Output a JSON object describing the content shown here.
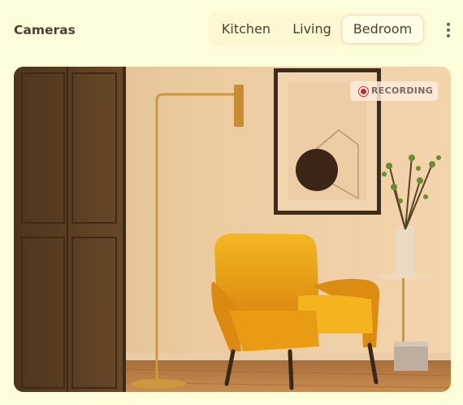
{
  "header": {
    "title": "Cameras",
    "tabs": [
      "Kitchen",
      "Living",
      "Bedroom"
    ],
    "active_tab": "Bedroom"
  },
  "feed": {
    "status_label": "RECORDING",
    "status_color": "#d9231f"
  },
  "icons": {
    "more": "more-vertical-icon",
    "recording": "record-dot-icon"
  }
}
